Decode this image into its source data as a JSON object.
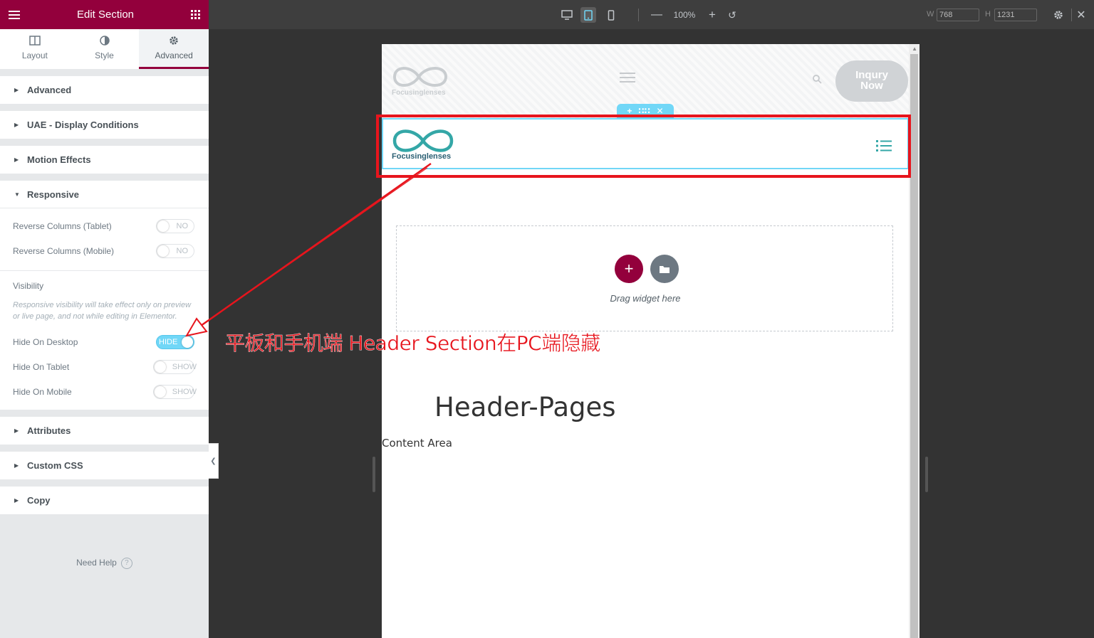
{
  "panel": {
    "title": "Edit Section",
    "tabs": [
      {
        "label": "Layout",
        "icon": "columns-icon"
      },
      {
        "label": "Style",
        "icon": "half-circle-icon"
      },
      {
        "label": "Advanced",
        "icon": "gear-icon",
        "active": true
      }
    ],
    "sections": {
      "advanced": "Advanced",
      "display_conditions": "UAE - Display Conditions",
      "motion_effects": "Motion Effects",
      "responsive": "Responsive",
      "attributes": "Attributes",
      "custom_css": "Custom CSS",
      "copy": "Copy"
    },
    "responsive": {
      "reverse_tablet": {
        "label": "Reverse Columns (Tablet)",
        "state": "NO"
      },
      "reverse_mobile": {
        "label": "Reverse Columns (Mobile)",
        "state": "NO"
      },
      "visibility_title": "Visibility",
      "visibility_note": "Responsive visibility will take effect only on preview or live page, and not while editing in Elementor.",
      "hide_desktop": {
        "label": "Hide On Desktop",
        "state": "HIDE"
      },
      "hide_tablet": {
        "label": "Hide On Tablet",
        "state": "SHOW"
      },
      "hide_mobile": {
        "label": "Hide On Mobile",
        "state": "SHOW"
      }
    },
    "need_help": "Need Help",
    "accent_color": "#93003c"
  },
  "topbar": {
    "zoom": "100%",
    "width_label": "W",
    "width_value": "768",
    "height_label": "H",
    "height_value": "1231"
  },
  "preview": {
    "logo_text": "Focusinglenses",
    "inquiry_button": "Inqury Now",
    "drag_text": "Drag widget here",
    "page_title": "Header-Pages",
    "content_area": "Content Area",
    "brand_color": "#34a7a7"
  },
  "annotation": {
    "text": "平板和手机端 Header Section在PC端隐藏",
    "color": "#e7151d"
  }
}
